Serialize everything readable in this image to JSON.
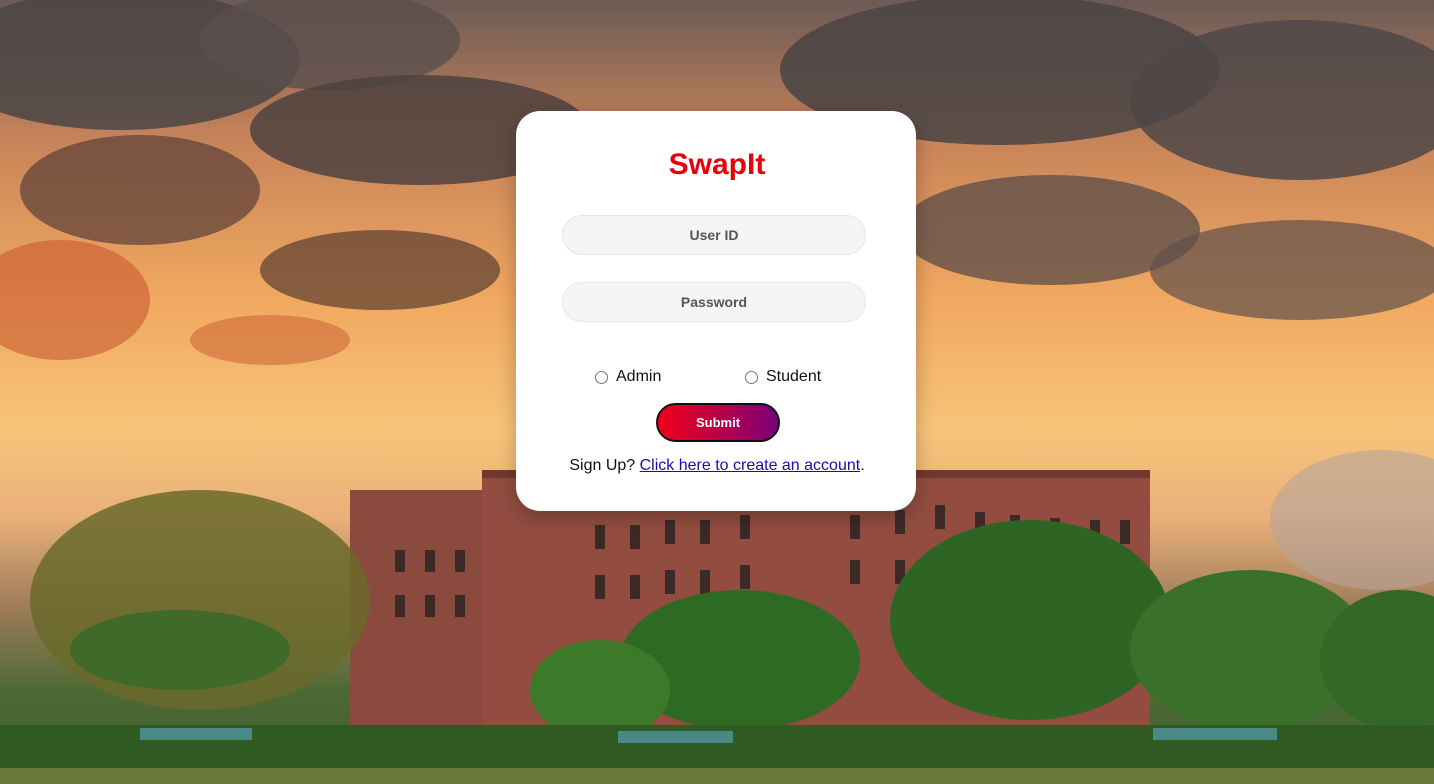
{
  "app": {
    "title": "SwapIt"
  },
  "login_form": {
    "userid_placeholder": "User ID",
    "password_placeholder": "Password",
    "roles": [
      {
        "label": "Admin",
        "selected": false
      },
      {
        "label": "Student",
        "selected": false
      }
    ],
    "submit_label": "Submit",
    "signup_prefix": "Sign Up? ",
    "signup_link": "Click here to create an account",
    "signup_suffix": "."
  },
  "colors": {
    "title": "#e8000a",
    "button_gradient_start": "#f0001a",
    "button_gradient_end": "#7a007a",
    "link": "#1a0dab"
  },
  "background": {
    "description_icon": "campus-sunset-photo"
  }
}
